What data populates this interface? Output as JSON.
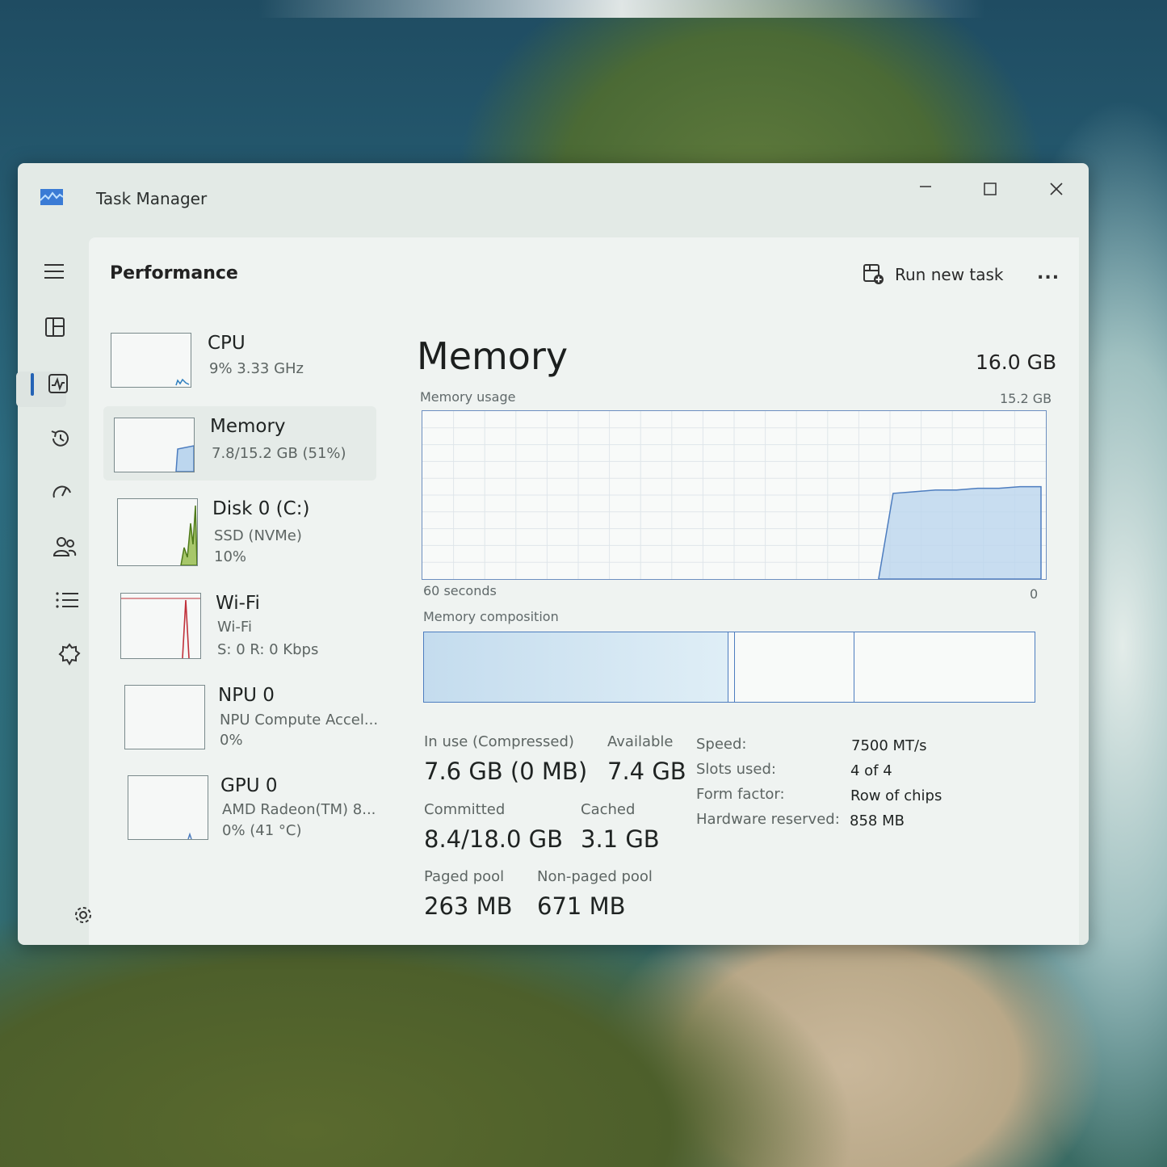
{
  "window": {
    "title": "Task Manager",
    "accent_color": "#2563b5"
  },
  "header": {
    "page_title": "Performance",
    "run_new_task_label": "Run new task",
    "more_label": "..."
  },
  "nav_icons": [
    "hamburger-icon",
    "processes-icon",
    "performance-icon",
    "app-history-icon",
    "startup-apps-icon",
    "users-icon",
    "details-icon",
    "services-icon",
    "settings-icon"
  ],
  "sidebar": {
    "items": [
      {
        "name": "CPU",
        "line1": "9%  3.33 GHz",
        "line2": "",
        "color": "#2f7fbf"
      },
      {
        "name": "Memory",
        "line1": "7.8/15.2 GB (51%)",
        "line2": "",
        "color": "#4d7dbf"
      },
      {
        "name": "Disk 0 (C:)",
        "line1": "SSD (NVMe)",
        "line2": "10%",
        "color": "#6a9a2a"
      },
      {
        "name": "Wi-Fi",
        "line1": "Wi-Fi",
        "line2": "S: 0 R: 0 Kbps",
        "color": "#c0303a"
      },
      {
        "name": "NPU 0",
        "line1": "NPU Compute Accel...",
        "line2": "0%",
        "color": "#4d7dbf"
      },
      {
        "name": "GPU 0",
        "line1": "AMD Radeon(TM) 8...",
        "line2": "0% (41 °C)",
        "color": "#4d7dbf"
      }
    ]
  },
  "memory": {
    "title": "Memory",
    "total": "16.0 GB",
    "usage_label": "Memory usage",
    "usage_max": "15.2 GB",
    "axis_left": "60 seconds",
    "axis_right": "0",
    "composition_label": "Memory composition",
    "usage_history_percent": [
      51,
      52,
      53,
      53,
      54,
      54,
      55,
      55
    ],
    "stats": {
      "in_use_label": "In use (Compressed)",
      "in_use_value": "7.6 GB (0 MB)",
      "available_label": "Available",
      "available_value": "7.4 GB",
      "committed_label": "Committed",
      "committed_value": "8.4/18.0 GB",
      "cached_label": "Cached",
      "cached_value": "3.1 GB",
      "paged_label": "Paged pool",
      "paged_value": "263 MB",
      "nonpaged_label": "Non-paged pool",
      "nonpaged_value": "671 MB"
    },
    "details": {
      "speed_label": "Speed:",
      "speed_value": "7500 MT/s",
      "slots_label": "Slots used:",
      "slots_value": "4 of 4",
      "form_label": "Form factor:",
      "form_value": "Row of chips",
      "hw_label": "Hardware reserved:",
      "hw_value": "858 MB"
    }
  }
}
